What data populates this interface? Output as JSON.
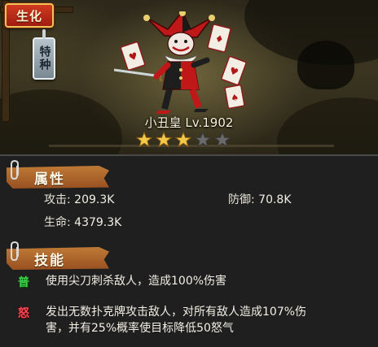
{
  "hero": {
    "transform_label": "生化",
    "type_label": "特种",
    "name": "小丑皇",
    "level": "Lv.1902",
    "stars": [
      true,
      true,
      true,
      false,
      false
    ],
    "star_colors": {
      "filled": "#f2c84a",
      "empty": "#6a6a6a"
    }
  },
  "attributes": {
    "title": "属性",
    "attack_label": "攻击:",
    "attack_value": "209.3K",
    "defense_label": "防御:",
    "defense_value": "70.8K",
    "hp_label": "生命:",
    "hp_value": "4379.3K"
  },
  "skills": {
    "title": "技能",
    "normal_icon": "普",
    "normal_text": "使用尖刀刺杀敌人，造成100%伤害",
    "rage_icon": "怒",
    "rage_text_line1": "发出无数扑克牌攻击敌人，对所有敌人造成107%伤",
    "rage_text_line2": "害，并有25%概率使目标降低50怒气"
  },
  "colors": {
    "header_orange": "#b8682a",
    "normal_green": "#3fd34a",
    "rage_red": "#ff4a5a",
    "badge_red": "#c02a18"
  }
}
